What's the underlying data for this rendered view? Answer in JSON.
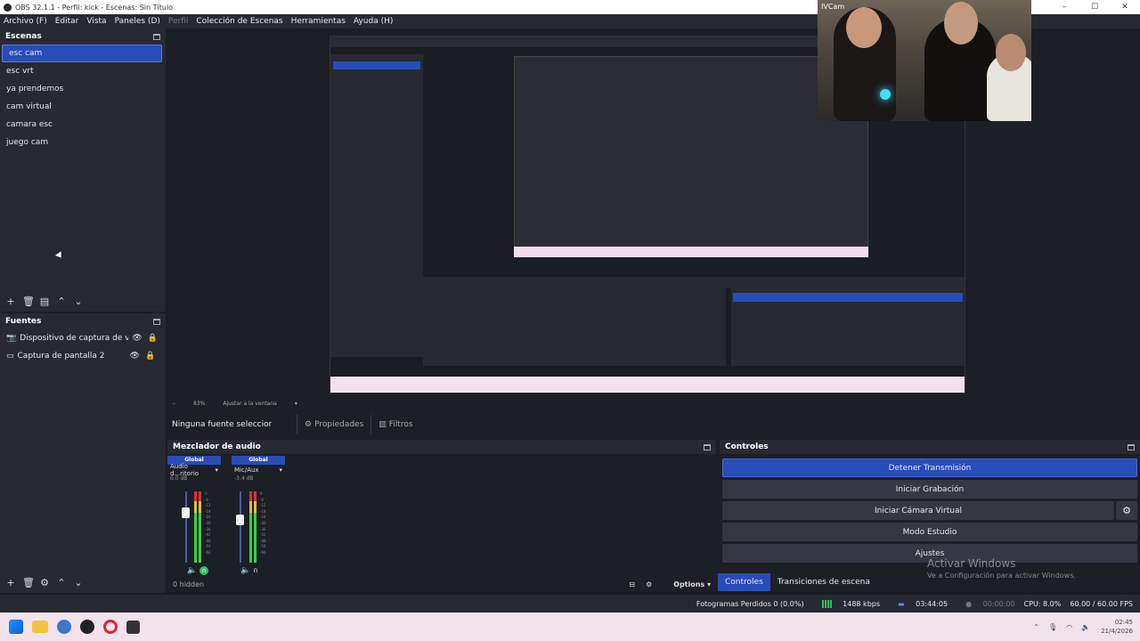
{
  "window": {
    "title": "OBS 32.1.1 - Perfil: kick - Escenas: Sin Título",
    "minimize": "–",
    "maximize": "☐",
    "close": "✕"
  },
  "menu": [
    "Archivo (F)",
    "Editar",
    "Vista",
    "Paneles (D)",
    "Perfil",
    "Colección de Escenas",
    "Herramientas",
    "Ayuda (H)"
  ],
  "scenes": {
    "title": "Escenas",
    "items": [
      "esc cam",
      "esc vrt",
      "ya prendemos",
      "cam virtual",
      "camara esc",
      "juego cam"
    ],
    "selected": "esc cam"
  },
  "sources": {
    "title": "Fuentes",
    "items": [
      "Dispositivo de captura de video",
      "Captura de pantalla 2"
    ]
  },
  "preview": {
    "cam_label": "IVCam",
    "zoom_label": "83%",
    "fit_label": "Ajustar a la ventana"
  },
  "source_bar": {
    "no_source": "Ninguna fuente seleccionada",
    "properties": "Propiedades",
    "filters": "Filtros"
  },
  "mixer": {
    "title": "Mezclador de audio",
    "channels": [
      {
        "scope": "Global",
        "name": "Audio d...ritorio",
        "db": "0.0 dB"
      },
      {
        "scope": "Global",
        "name": "Mic/Aux",
        "db": "-3.4 dB"
      }
    ],
    "ticks": [
      "0",
      "-6",
      "-12",
      "-18",
      "-24",
      "-30",
      "-36",
      "-42",
      "-48",
      "-54",
      "-60"
    ],
    "hidden": "0 hidden",
    "options": "Options"
  },
  "controls": {
    "title": "Controles",
    "buttons": [
      "Detener Transmisión",
      "Iniciar Grabación",
      "Iniciar Cámara Virtual",
      "Modo Estudio",
      "Ajustes"
    ],
    "tabs": [
      "Controles",
      "Transiciones de escena"
    ]
  },
  "watermark": {
    "line1": "Activar Windows",
    "line2": "Ve a Configuración para activar Windows."
  },
  "status": {
    "dropped": "Fotogramas Perdidos 0 (0.0%)",
    "bitrate": "1488 kbps",
    "stream_time": "03:44:05",
    "rec_time": "00:00:00",
    "cpu": "CPU: 8.0%",
    "fps": "60.00 / 60.00 FPS"
  },
  "tray": {
    "time": "02:45",
    "date": "21/4/2026"
  },
  "colors": {
    "accent": "#284cb8",
    "panel": "#272a33",
    "bg": "#1d1f26"
  }
}
